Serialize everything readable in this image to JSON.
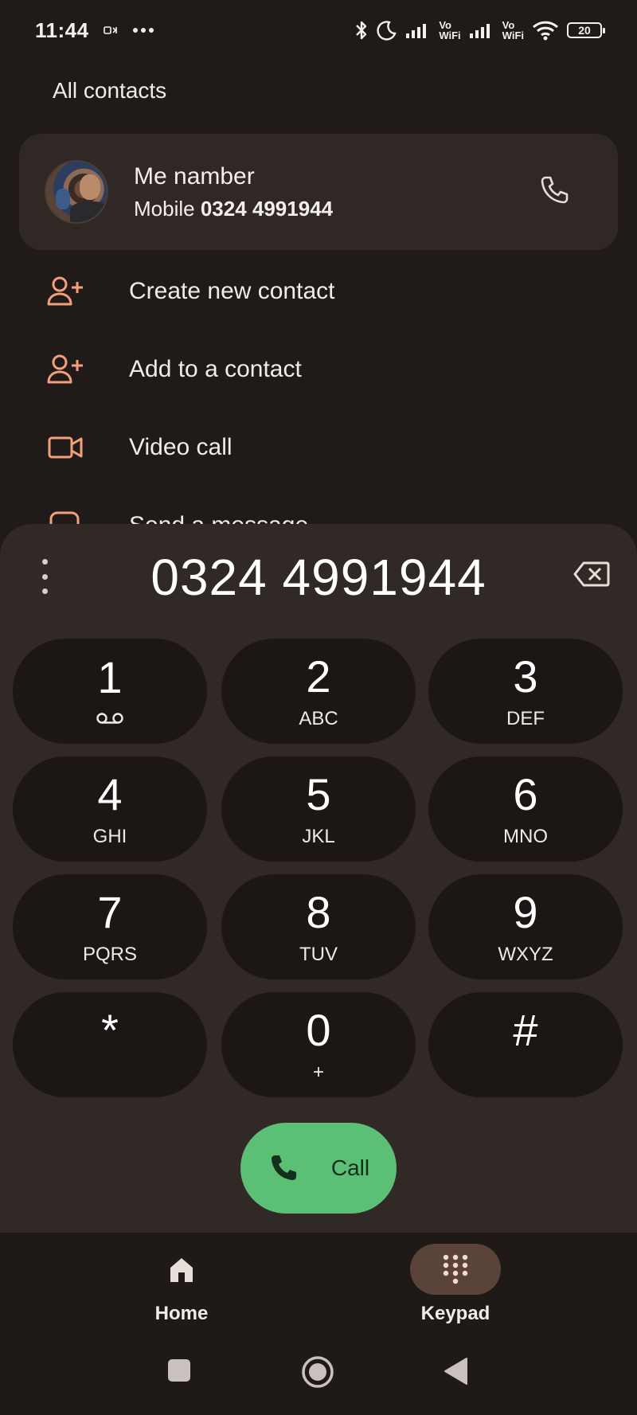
{
  "status_bar": {
    "time": "11:44",
    "vowifi_1_top": "Vo",
    "vowifi_1_bottom": "WiFi",
    "vowifi_2_top": "Vo",
    "vowifi_2_bottom": "WiFi",
    "battery": "20"
  },
  "header": {
    "title": "All contacts"
  },
  "contact": {
    "name": "Me namber",
    "type_label": "Mobile",
    "number": "0324 4991944"
  },
  "actions": [
    {
      "label": "Create new contact",
      "icon": "person-add-icon"
    },
    {
      "label": "Add to a contact",
      "icon": "person-add-icon"
    },
    {
      "label": "Video call",
      "icon": "videocam-icon"
    },
    {
      "label": "Send a message",
      "icon": "message-icon"
    }
  ],
  "dialer": {
    "number": "0324 4991944",
    "keys": [
      {
        "digit": "1",
        "letters": ""
      },
      {
        "digit": "2",
        "letters": "ABC"
      },
      {
        "digit": "3",
        "letters": "DEF"
      },
      {
        "digit": "4",
        "letters": "GHI"
      },
      {
        "digit": "5",
        "letters": "JKL"
      },
      {
        "digit": "6",
        "letters": "MNO"
      },
      {
        "digit": "7",
        "letters": "PQRS"
      },
      {
        "digit": "8",
        "letters": "TUV"
      },
      {
        "digit": "9",
        "letters": "WXYZ"
      },
      {
        "digit": "*",
        "letters": ""
      },
      {
        "digit": "0",
        "letters": "+"
      },
      {
        "digit": "#",
        "letters": ""
      }
    ],
    "call_label": "Call"
  },
  "bottom_nav": {
    "home_label": "Home",
    "keypad_label": "Keypad",
    "active": "Keypad"
  },
  "colors": {
    "accent_icon": "#f2a07b",
    "call_green": "#5bbf76",
    "active_pill": "#5a4338"
  }
}
